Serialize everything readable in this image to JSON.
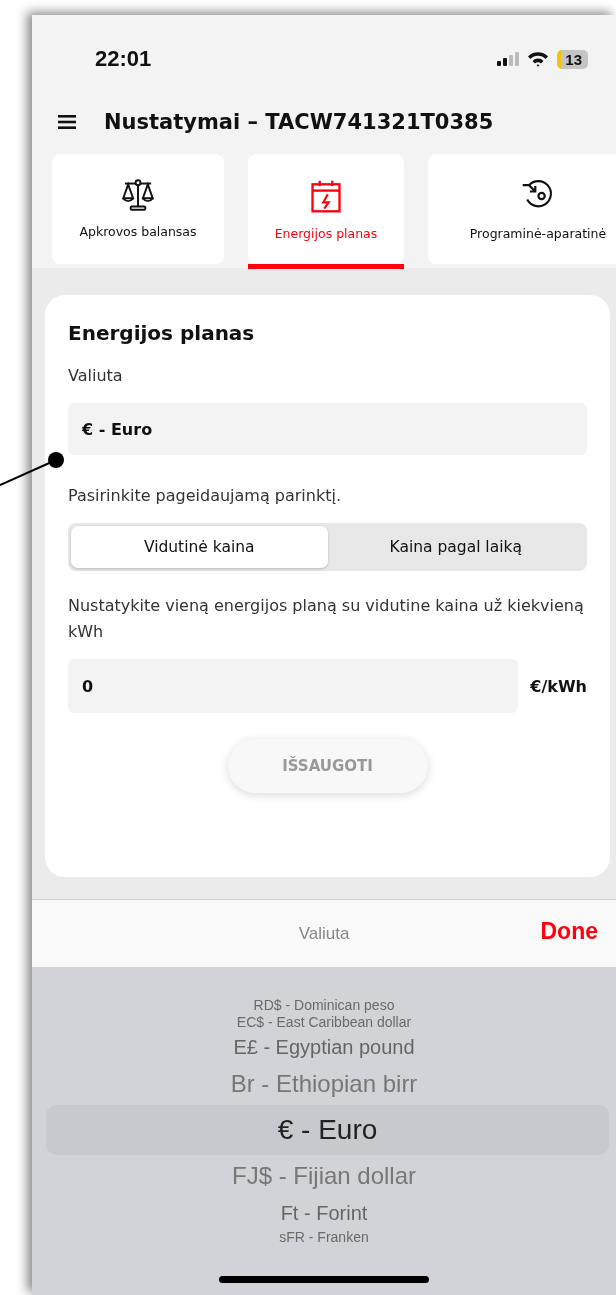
{
  "status_bar": {
    "time": "22:01",
    "battery": "13"
  },
  "header": {
    "title": "Nustatymai – TACW741321T0385"
  },
  "tabs": [
    {
      "label": "Apkrovos balansas",
      "selected": false
    },
    {
      "label": "Energijos planas",
      "selected": true
    },
    {
      "label": "Programinė-aparatinė",
      "selected": false
    }
  ],
  "card": {
    "title": "Energijos planas",
    "currency_label": "Valiuta",
    "currency_value": "€ - Euro",
    "option_prompt": "Pasirinkite pageidaujamą parinktį.",
    "segments": [
      {
        "label": "Vidutinė kaina",
        "selected": true
      },
      {
        "label": "Kaina pagal laiką",
        "selected": false
      }
    ],
    "price_prompt": "Nustatykite vieną energijos planą su vidutine kaina už kiekvieną kWh",
    "price_value": "0",
    "price_unit": "€/kWh",
    "save_button": {
      "label": "IŠSAUGOTI",
      "disabled": true
    }
  },
  "picker": {
    "title": "Valiuta",
    "done": "Done",
    "options": [
      {
        "label": "RD$ - Dominican peso",
        "selected": false
      },
      {
        "label": "EC$ - East Caribbean dollar",
        "selected": false
      },
      {
        "label": "E£ - Egyptian pound",
        "selected": false
      },
      {
        "label": "Br - Ethiopian birr",
        "selected": false
      },
      {
        "label": "€ - Euro",
        "selected": true
      },
      {
        "label": "FJ$ - Fijian dollar",
        "selected": false
      },
      {
        "label": "Ft - Forint",
        "selected": false
      },
      {
        "label": "sFR - Franken",
        "selected": false
      }
    ]
  }
}
